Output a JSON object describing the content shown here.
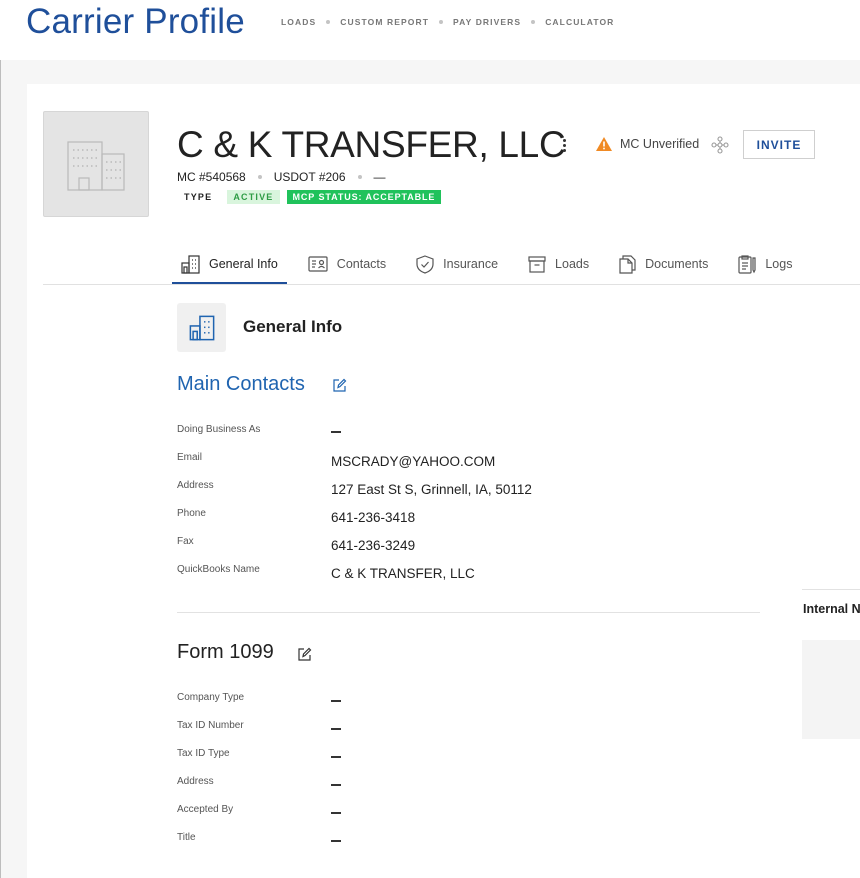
{
  "app": {
    "title": "Carrier Profile"
  },
  "nav": {
    "items": [
      "LOADS",
      "CUSTOM REPORT",
      "PAY DRIVERS",
      "CALCULATOR"
    ]
  },
  "carrier": {
    "name": "C & K TRANSFER, LLC",
    "mc": "MC #540568",
    "usdot": "USDOT #206",
    "extra": "—",
    "verification": "MC Unverified",
    "invite_label": "INVITE",
    "type_label": "TYPE",
    "active_badge": "ACTIVE",
    "mcp_badge": "MCP STATUS: ACCEPTABLE"
  },
  "tabs": [
    {
      "label": "General Info",
      "icon": "building-icon",
      "active": true
    },
    {
      "label": "Contacts",
      "icon": "contact-card-icon",
      "active": false
    },
    {
      "label": "Insurance",
      "icon": "shield-check-icon",
      "active": false
    },
    {
      "label": "Loads",
      "icon": "archive-box-icon",
      "active": false
    },
    {
      "label": "Documents",
      "icon": "documents-icon",
      "active": false
    },
    {
      "label": "Logs",
      "icon": "clipboard-log-icon",
      "active": false
    }
  ],
  "general_info": {
    "title": "General Info"
  },
  "main_contacts": {
    "title": "Main Contacts",
    "fields": [
      {
        "label": "Doing Business As",
        "value": ""
      },
      {
        "label": "Email",
        "value": "MSCRADY@YAHOO.COM"
      },
      {
        "label": "Address",
        "value": "127 East St S, Grinnell, IA, 50112"
      },
      {
        "label": "Phone",
        "value": "641-236-3418"
      },
      {
        "label": "Fax",
        "value": "641-236-3249"
      },
      {
        "label": "QuickBooks Name",
        "value": "C & K TRANSFER, LLC"
      }
    ]
  },
  "form_1099": {
    "title": "Form 1099",
    "fields": [
      {
        "label": "Company Type",
        "value": ""
      },
      {
        "label": "Tax ID Number",
        "value": ""
      },
      {
        "label": "Tax ID Type",
        "value": ""
      },
      {
        "label": "Address",
        "value": ""
      },
      {
        "label": "Accepted By",
        "value": ""
      },
      {
        "label": "Title",
        "value": ""
      }
    ]
  },
  "internal_notes": {
    "title": "Internal Notes"
  },
  "colors": {
    "brand": "#1f4f9a",
    "link": "#1f64b0",
    "success": "#20c25b",
    "warning": "#f08a24"
  }
}
